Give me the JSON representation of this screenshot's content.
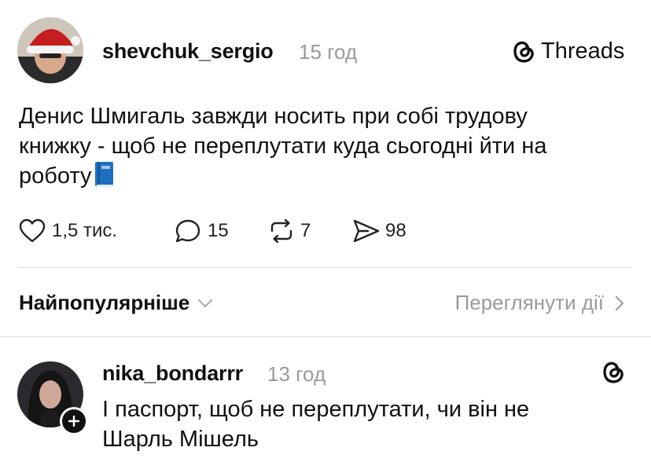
{
  "post": {
    "author": "shevchuk_sergio",
    "time": "15 год",
    "brand": "Threads",
    "text_line1": "Денис Шмигаль завжди носить при собі трудову",
    "text_line2": "книжку - щоб не переплутати куда сьогодні йти на",
    "text_line3": "роботу",
    "emoji": "📘",
    "metrics": {
      "likes": "1,5 тис.",
      "replies": "15",
      "reposts": "7",
      "shares": "98"
    }
  },
  "sorting": {
    "label": "Найпопулярніше",
    "view_activity": "Переглянути дії"
  },
  "reply": {
    "author": "nika_bondarrr",
    "time": "13 год",
    "text_line1": "І паспорт, щоб не переплутати, чи він не",
    "text_line2": "Шарль Мішель"
  },
  "colors": {
    "text": "#111111",
    "muted": "#9a9a9a",
    "divider": "#dcdcdc"
  }
}
